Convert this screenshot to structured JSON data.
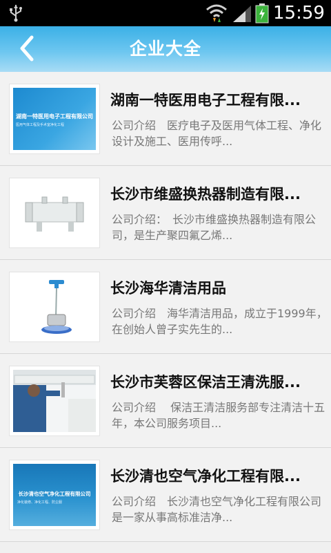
{
  "status": {
    "time": "15:59"
  },
  "header": {
    "title": "企业大全"
  },
  "companies": [
    {
      "name": "湖南一特医用电子工程有限...",
      "desc": "公司介绍　医疗电子及医用气体工程、净化设计及施工、医用传呼...",
      "thumb": {
        "title": "湖南一特医用电子工程有限公司",
        "subtitle": "医用气体工程及手术室净化工程"
      }
    },
    {
      "name": "长沙市维盛换热器制造有限...",
      "desc": "公司介绍：　长沙市维盛换热器制造有限公司，是生产聚四氟乙烯..."
    },
    {
      "name": "长沙海华清洁用品",
      "desc": "公司介绍　海华清洁用品，成立于1999年，在创始人曾子实先生的..."
    },
    {
      "name": "长沙市芙蓉区保洁王清洗服...",
      "desc": "公司介绍　 保洁王清洁服务部专注清洁十五年，本公司服务项目..."
    },
    {
      "name": "长沙清也空气净化工程有限...",
      "desc": "公司介绍　长沙清也空气净化工程有限公司是一家从事高标准洁净...",
      "thumb": {
        "title": "长沙清也空气净化工程有限公司",
        "subtitle": "净化装修、净化工程、防尘服"
      }
    }
  ]
}
